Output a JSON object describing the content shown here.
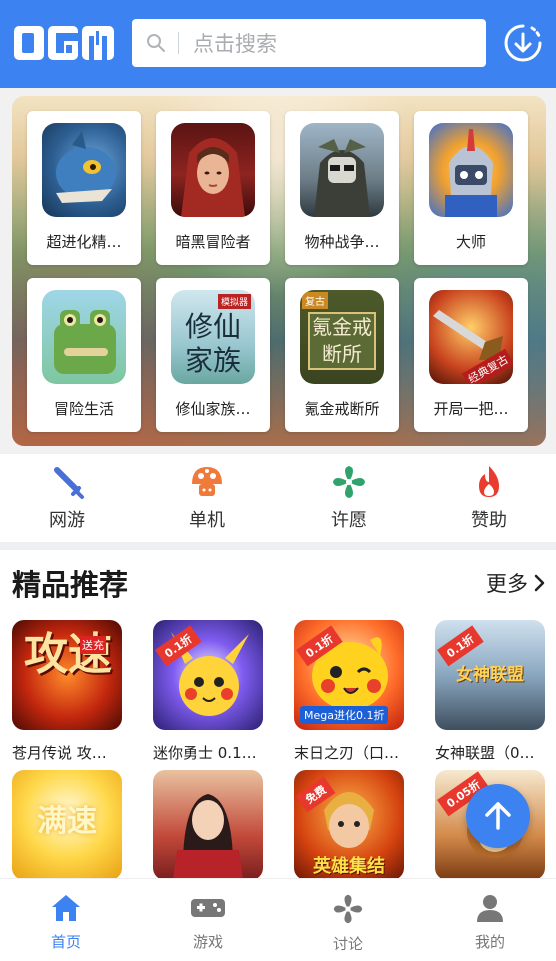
{
  "header": {
    "logo_text": "DGM",
    "search_placeholder": "点击搜索",
    "brand_color": "#3c82f0"
  },
  "banner": {
    "games": [
      {
        "name": "超进化精…",
        "icon": "blue-dragon-art"
      },
      {
        "name": "暗黑冒险者",
        "icon": "red-hood-woman-art"
      },
      {
        "name": "物种战争…",
        "icon": "armored-soldier-art"
      },
      {
        "name": "大师",
        "icon": "knight-helmet-art"
      },
      {
        "name": "冒险生活",
        "icon": "pixel-frog-art"
      },
      {
        "name": "修仙家族…",
        "icon": "xiuxian-calligraphy-art",
        "art_text": "修仙家族",
        "art_tag": "模拟器"
      },
      {
        "name": "氪金戒断所",
        "icon": "kejin-sign-art",
        "art_text": "氪金戒断所",
        "art_tag": "复古"
      },
      {
        "name": "开局一把…",
        "icon": "sword-art",
        "art_tag": "经典复古"
      }
    ]
  },
  "quick_nav": [
    {
      "label": "网游",
      "icon": "sword-icon",
      "color": "#4a6fd6"
    },
    {
      "label": "单机",
      "icon": "mushroom-icon",
      "color": "#f07a3a"
    },
    {
      "label": "许愿",
      "icon": "pinwheel-icon",
      "color": "#2fa36b"
    },
    {
      "label": "赞助",
      "icon": "flame-icon",
      "color": "#ea3b2f"
    }
  ],
  "section": {
    "title": "精品推荐",
    "more": "更多"
  },
  "recommended": [
    {
      "name": "苍月传说 攻…",
      "art_text": "攻速",
      "art_tag": "送充"
    },
    {
      "name": "迷你勇士 0.1…",
      "badge": "0.1折"
    },
    {
      "name": "末日之刃（口…",
      "badge": "0.1折",
      "art_tag": "Mega进化0.1折"
    },
    {
      "name": "女神联盟（0…",
      "badge": "0.1折",
      "art_text": "女神联盟"
    },
    {
      "name": "",
      "art_text": "满速"
    },
    {
      "name": ""
    },
    {
      "name": "",
      "badge": "免费",
      "art_text": "英雄集结"
    },
    {
      "name": "",
      "badge": "0.05折"
    }
  ],
  "bottom_nav": [
    {
      "label": "首页",
      "icon": "home-icon",
      "active": true
    },
    {
      "label": "游戏",
      "icon": "gamepad-icon",
      "active": false
    },
    {
      "label": "讨论",
      "icon": "pinwheel-icon",
      "active": false
    },
    {
      "label": "我的",
      "icon": "user-icon",
      "active": false
    }
  ]
}
